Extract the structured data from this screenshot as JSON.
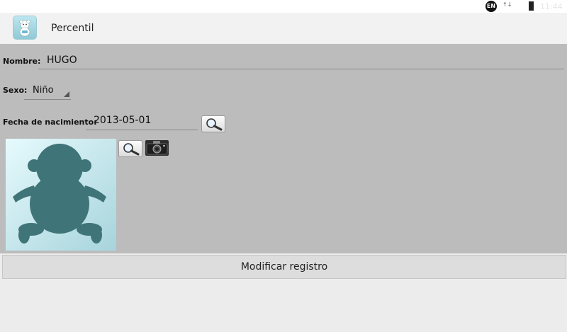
{
  "statusbar": {
    "lang_badge": "EN",
    "signal": "↑↓",
    "time": "11:44"
  },
  "actionbar": {
    "title": "Percentil",
    "app_icon": "baby-bear-icon"
  },
  "form": {
    "nombre_label": "Nombre:",
    "nombre_value": "HUGO",
    "sexo_label": "Sexo:",
    "sexo_value": "Niño",
    "fecha_label": "Fecha de nacimiento:",
    "fecha_value": "2013-05-01",
    "photo_icon": "baby-silhouette-icon",
    "search_icon": "magnifier-icon",
    "camera_icon": "camera-icon"
  },
  "actions": {
    "modify_label": "Modificar registro"
  },
  "colors": {
    "form_bg": "#bcbcbc",
    "page_bg": "#ececec",
    "silhouette": "#3f7478"
  }
}
